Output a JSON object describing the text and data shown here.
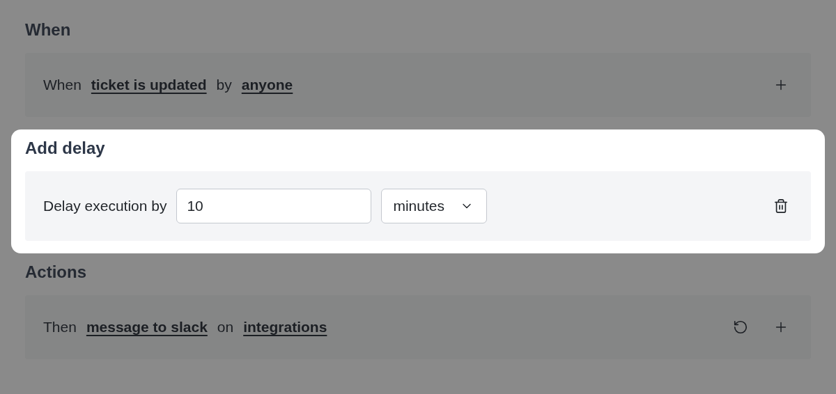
{
  "sections": [
    {
      "title": "When",
      "highlighted": false,
      "parts": [
        {
          "kind": "text",
          "text": "When"
        },
        {
          "kind": "link",
          "text": "ticket is updated"
        },
        {
          "kind": "text",
          "text": "by"
        },
        {
          "kind": "link",
          "text": "anyone"
        }
      ],
      "actions": [
        {
          "kind": "add"
        }
      ]
    },
    {
      "title": "Add delay",
      "highlighted": true,
      "parts": [
        {
          "kind": "text",
          "text": "Delay execution by"
        },
        {
          "kind": "input",
          "value": "10"
        },
        {
          "kind": "select",
          "value": "minutes"
        }
      ],
      "actions": [
        {
          "kind": "delete"
        }
      ]
    },
    {
      "title": "Actions",
      "highlighted": false,
      "parts": [
        {
          "kind": "text",
          "text": "Then"
        },
        {
          "kind": "link",
          "text": "message to slack"
        },
        {
          "kind": "text",
          "text": "on"
        },
        {
          "kind": "link",
          "text": "integrations"
        }
      ],
      "actions": [
        {
          "kind": "refresh"
        },
        {
          "kind": "add"
        }
      ]
    }
  ]
}
